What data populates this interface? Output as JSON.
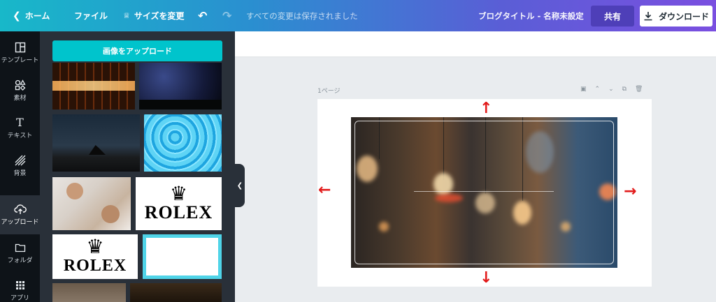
{
  "topbar": {
    "home_label": "ホーム",
    "file_label": "ファイル",
    "resize_label": "サイズを変更",
    "saved_status": "すべての変更は保存されました",
    "doc_title": "ブログタイトル - 名称未設定",
    "share_label": "共有",
    "download_label": "ダウンロード"
  },
  "rail": {
    "items": [
      {
        "label": "テンプレート",
        "icon": "template-icon"
      },
      {
        "label": "素材",
        "icon": "shapes-icon"
      },
      {
        "label": "テキスト",
        "icon": "text-icon"
      },
      {
        "label": "背景",
        "icon": "background-icon"
      },
      {
        "label": "アップロード",
        "icon": "cloud-upload-icon"
      },
      {
        "label": "フォルダ",
        "icon": "folder-icon"
      },
      {
        "label": "アプリ",
        "icon": "apps-grid-icon"
      }
    ],
    "active_index": 4
  },
  "panel": {
    "upload_button": "画像をアップロード",
    "thumb_logo_text": "ROLEX"
  },
  "canvas": {
    "page_label": "1ページ"
  },
  "colors": {
    "accent": "#00c4cc",
    "annotation_arrow": "#e21b1b"
  }
}
